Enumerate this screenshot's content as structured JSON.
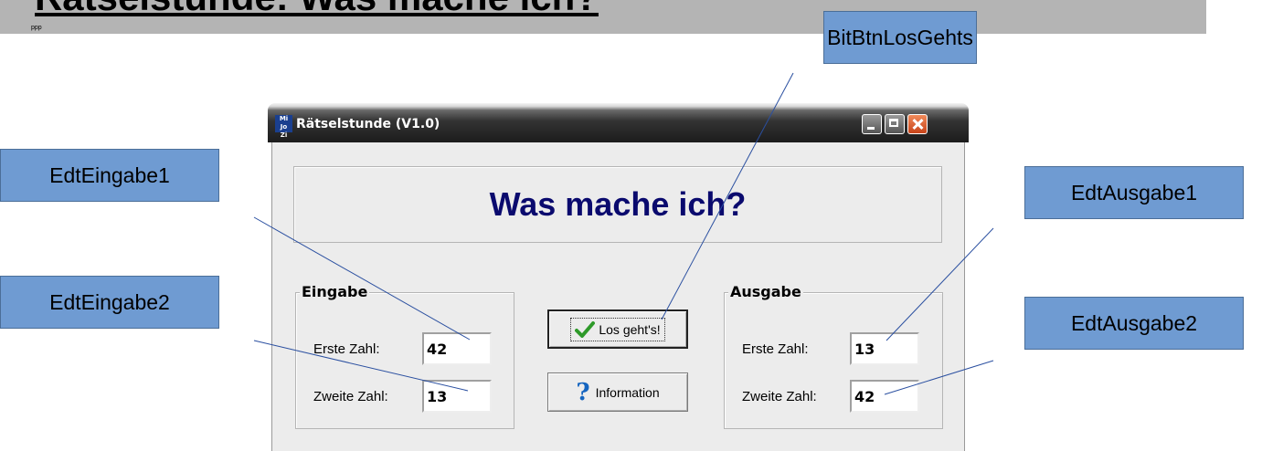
{
  "page": {
    "title": "Rätselstunde: Was mache ich?",
    "small_text": "ppp"
  },
  "callouts": {
    "bitbtn": "BitBtnLosGehts",
    "edt_eingabe1": "EdtEingabe1",
    "edt_eingabe2": "EdtEingabe2",
    "edt_ausgabe1": "EdtAusgabe1",
    "edt_ausgabe2": "EdtAusgabe2"
  },
  "window": {
    "title": "Rätselstunde (V1.0)",
    "icon_text": "Mi Jo Zi",
    "header": "Was mache ich?",
    "eingabe": {
      "legend": "Eingabe",
      "first_label": "Erste Zahl:",
      "first_value": "42",
      "second_label": "Zweite Zahl:",
      "second_value": "13"
    },
    "ausgabe": {
      "legend": "Ausgabe",
      "first_label": "Erste Zahl:",
      "first_value": "13",
      "second_label": "Zweite Zahl:",
      "second_value": "42"
    },
    "buttons": {
      "go": "Los geht's!",
      "info": "Information"
    }
  },
  "colors": {
    "callout": "#6f9bd2",
    "header_text": "#0a0a6e",
    "title_band": "#b4b4b4"
  },
  "icons": [
    "check-icon",
    "question-icon",
    "minimize-icon",
    "maximize-icon",
    "close-icon"
  ]
}
